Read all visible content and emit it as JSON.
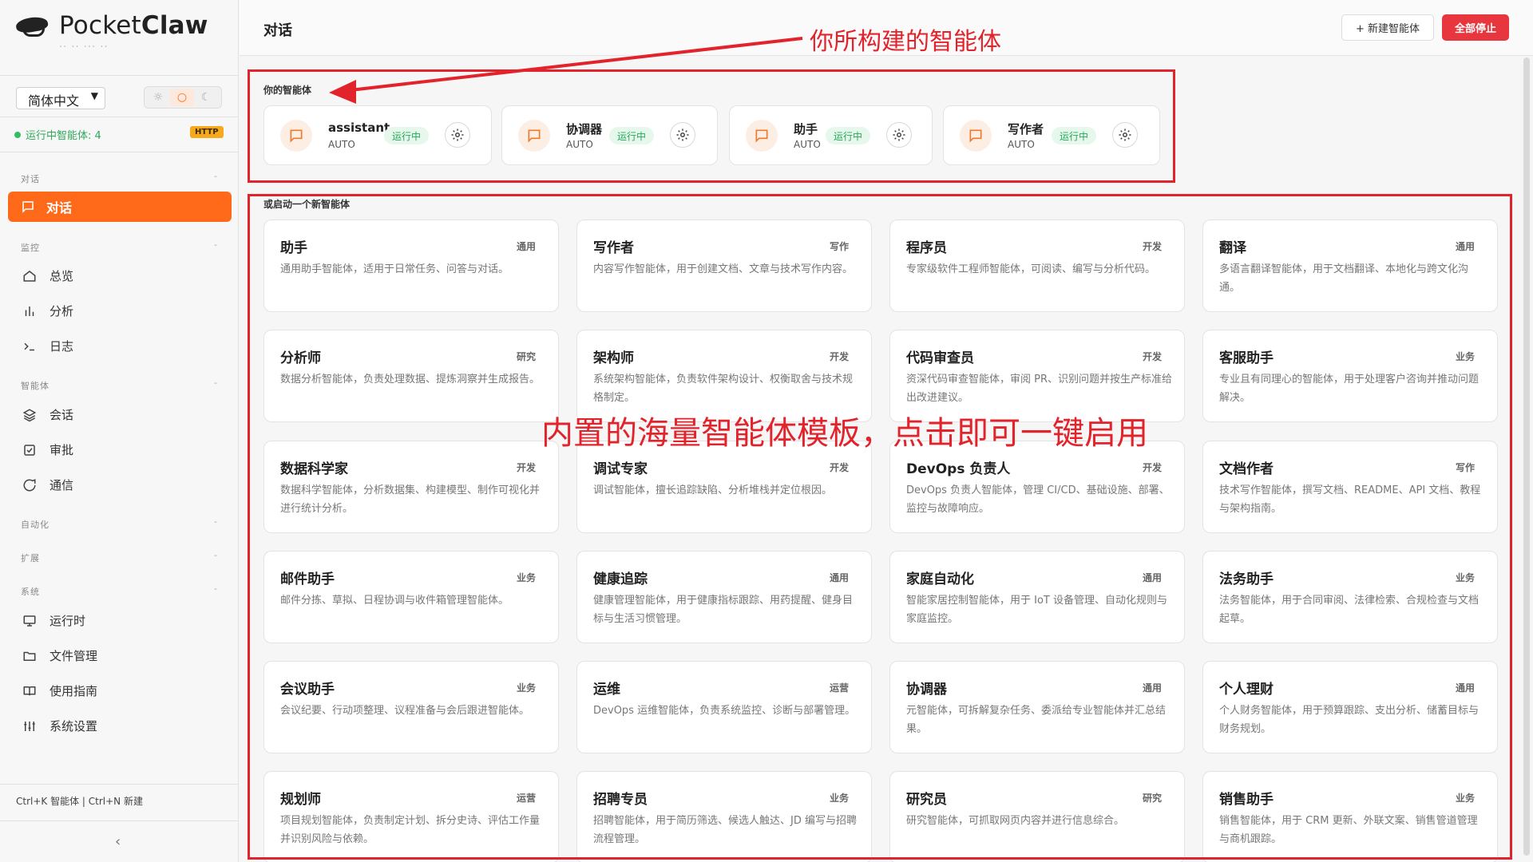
{
  "app": {
    "logo_light": "Pocket",
    "logo_bold": "Claw",
    "logo_sub": "·· ·· ··· ··"
  },
  "sidebar": {
    "language": "简体中文",
    "running_agents": "运行中智能体: 4",
    "http_badge": "HTTP",
    "groups": {
      "chat": "对话",
      "monitor": "监控",
      "agent": "智能体",
      "automation": "自动化",
      "extension": "扩展",
      "system": "系统"
    },
    "items": {
      "chat": "对话",
      "overview": "总览",
      "analysis": "分析",
      "logs": "日志",
      "sessions": "会话",
      "approval": "审批",
      "comms": "通信",
      "runtime": "运行时",
      "files": "文件管理",
      "guide": "使用指南",
      "settings": "系统设置"
    },
    "hotkeys": "Ctrl+K 智能体 | Ctrl+N 新建",
    "collapse_glyph": "‹"
  },
  "header": {
    "title": "对话",
    "new_agent": "+ 新建智能体",
    "stop_all": "全部停止"
  },
  "main": {
    "your_agents_label": "你的智能体",
    "start_new_label": "或启动一个新智能体",
    "running_agents": [
      {
        "name": "assistant",
        "mode": "AUTO",
        "status": "运行中"
      },
      {
        "name": "协调器",
        "mode": "AUTO",
        "status": "运行中"
      },
      {
        "name": "助手",
        "mode": "AUTO",
        "status": "运行中"
      },
      {
        "name": "写作者",
        "mode": "AUTO",
        "status": "运行中"
      }
    ],
    "templates": [
      {
        "name": "助手",
        "tag": "通用",
        "desc": "通用助手智能体，适用于日常任务、问答与对话。"
      },
      {
        "name": "写作者",
        "tag": "写作",
        "desc": "内容写作智能体，用于创建文档、文章与技术写作内容。"
      },
      {
        "name": "程序员",
        "tag": "开发",
        "desc": "专家级软件工程师智能体，可阅读、编写与分析代码。"
      },
      {
        "name": "翻译",
        "tag": "通用",
        "desc": "多语言翻译智能体，用于文档翻译、本地化与跨文化沟通。"
      },
      {
        "name": "分析师",
        "tag": "研究",
        "desc": "数据分析智能体，负责处理数据、提炼洞察并生成报告。"
      },
      {
        "name": "架构师",
        "tag": "开发",
        "desc": "系统架构智能体，负责软件架构设计、权衡取舍与技术规格制定。"
      },
      {
        "name": "代码审查员",
        "tag": "开发",
        "desc": "资深代码审查智能体，审阅 PR、识别问题并按生产标准给出改进建议。"
      },
      {
        "name": "客服助手",
        "tag": "业务",
        "desc": "专业且有同理心的智能体，用于处理客户咨询并推动问题解决。"
      },
      {
        "name": "数据科学家",
        "tag": "开发",
        "desc": "数据科学智能体，分析数据集、构建模型、制作可视化并进行统计分析。"
      },
      {
        "name": "调试专家",
        "tag": "开发",
        "desc": "调试智能体，擅长追踪缺陷、分析堆栈并定位根因。"
      },
      {
        "name": "DevOps 负责人",
        "tag": "开发",
        "desc": "DevOps 负责人智能体，管理 CI/CD、基础设施、部署、监控与故障响应。"
      },
      {
        "name": "文档作者",
        "tag": "写作",
        "desc": "技术写作智能体，撰写文档、README、API 文档、教程与架构指南。"
      },
      {
        "name": "邮件助手",
        "tag": "业务",
        "desc": "邮件分拣、草拟、日程协调与收件箱管理智能体。"
      },
      {
        "name": "健康追踪",
        "tag": "通用",
        "desc": "健康管理智能体，用于健康指标跟踪、用药提醒、健身目标与生活习惯管理。"
      },
      {
        "name": "家庭自动化",
        "tag": "通用",
        "desc": "智能家居控制智能体，用于 IoT 设备管理、自动化规则与家庭监控。"
      },
      {
        "name": "法务助手",
        "tag": "业务",
        "desc": "法务智能体，用于合同审阅、法律检索、合规检查与文档起草。"
      },
      {
        "name": "会议助手",
        "tag": "业务",
        "desc": "会议纪要、行动项整理、议程准备与会后跟进智能体。"
      },
      {
        "name": "运维",
        "tag": "运营",
        "desc": "DevOps 运维智能体，负责系统监控、诊断与部署管理。"
      },
      {
        "name": "协调器",
        "tag": "通用",
        "desc": "元智能体，可拆解复杂任务、委派给专业智能体并汇总结果。"
      },
      {
        "name": "个人理财",
        "tag": "通用",
        "desc": "个人财务智能体，用于预算跟踪、支出分析、储蓄目标与财务规划。"
      },
      {
        "name": "规划师",
        "tag": "运营",
        "desc": "项目规划智能体，负责制定计划、拆分史诗、评估工作量并识别风险与依赖。"
      },
      {
        "name": "招聘专员",
        "tag": "业务",
        "desc": "招聘智能体，用于简历筛选、候选人触达、JD 编写与招聘流程管理。"
      },
      {
        "name": "研究员",
        "tag": "研究",
        "desc": "研究智能体，可抓取网页内容并进行信息综合。"
      },
      {
        "name": "销售助手",
        "tag": "业务",
        "desc": "销售智能体，用于 CRM 更新、外联文案、销售管道管理与商机跟踪。"
      }
    ]
  },
  "annotations": {
    "top": "你所构建的智能体",
    "middle": "内置的海量智能体模板，点击即可一键启用",
    "color": "#e3232b"
  },
  "colors": {
    "accent": "#ff6a1a",
    "running_green": "#26a85a",
    "stop_red": "#e8363f"
  }
}
